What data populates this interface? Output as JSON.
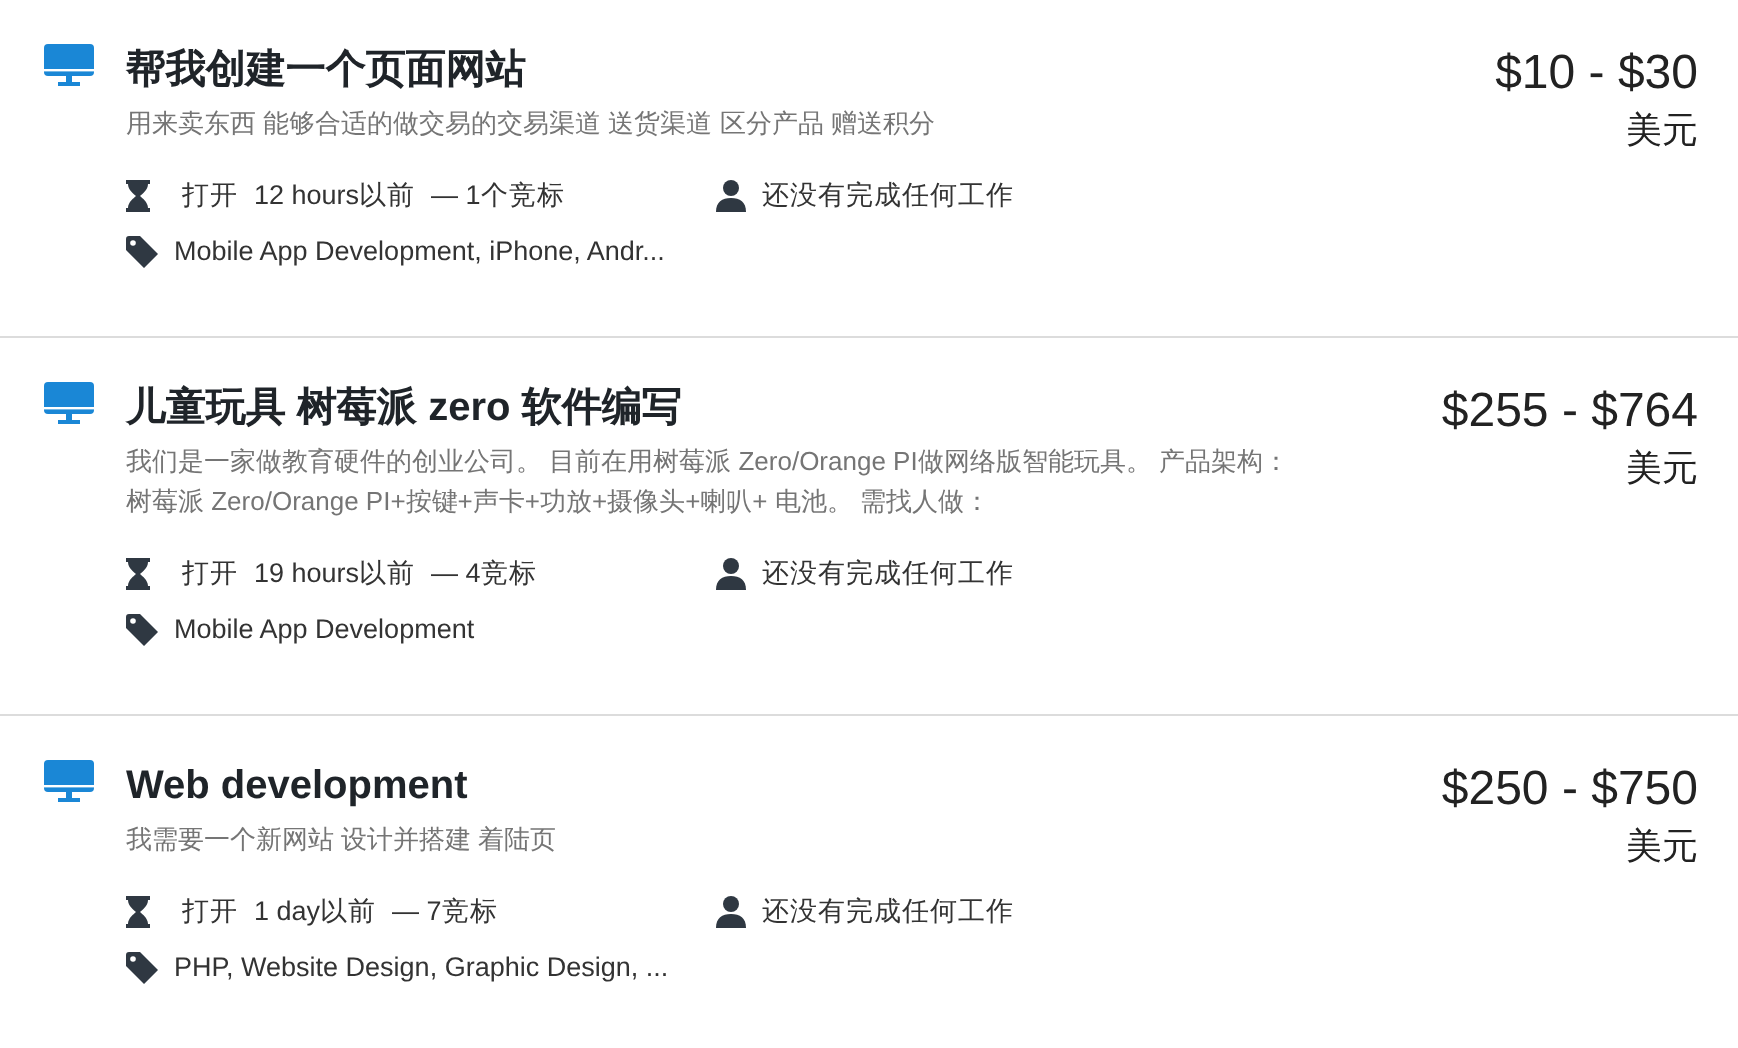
{
  "projects": [
    {
      "title": "帮我创建一个页面网站",
      "description": "用来卖东西 能够合适的做交易的交易渠道 送货渠道 区分产品 赠送积分",
      "status": "打开",
      "posted": "12 hours以前",
      "bids": "— 1个竞标",
      "employer": "还没有完成任何工作",
      "skills": "Mobile App Development, iPhone, Andr...",
      "budget": "$10 - $30",
      "currency": "美元"
    },
    {
      "title": "儿童玩具 树莓派 zero 软件编写",
      "description": "我们是一家做教育硬件的创业公司。 目前在用树莓派 Zero/Orange PI做网络版智能玩具。 产品架构：树莓派 Zero/Orange PI+按键+声卡+功放+摄像头+喇叭+ 电池。 需找人做：",
      "status": "打开",
      "posted": "19 hours以前",
      "bids": "— 4竞标",
      "employer": "还没有完成任何工作",
      "skills": "Mobile App Development",
      "budget": "$255 - $764",
      "currency": "美元"
    },
    {
      "title": "Web development",
      "description": "我需要一个新网站 设计并搭建 着陆页",
      "status": "打开",
      "posted": "1 day以前",
      "bids": "— 7竞标",
      "employer": "还没有完成任何工作",
      "skills": "PHP, Website Design, Graphic Design, ...",
      "budget": "$250 - $750",
      "currency": "美元"
    }
  ]
}
